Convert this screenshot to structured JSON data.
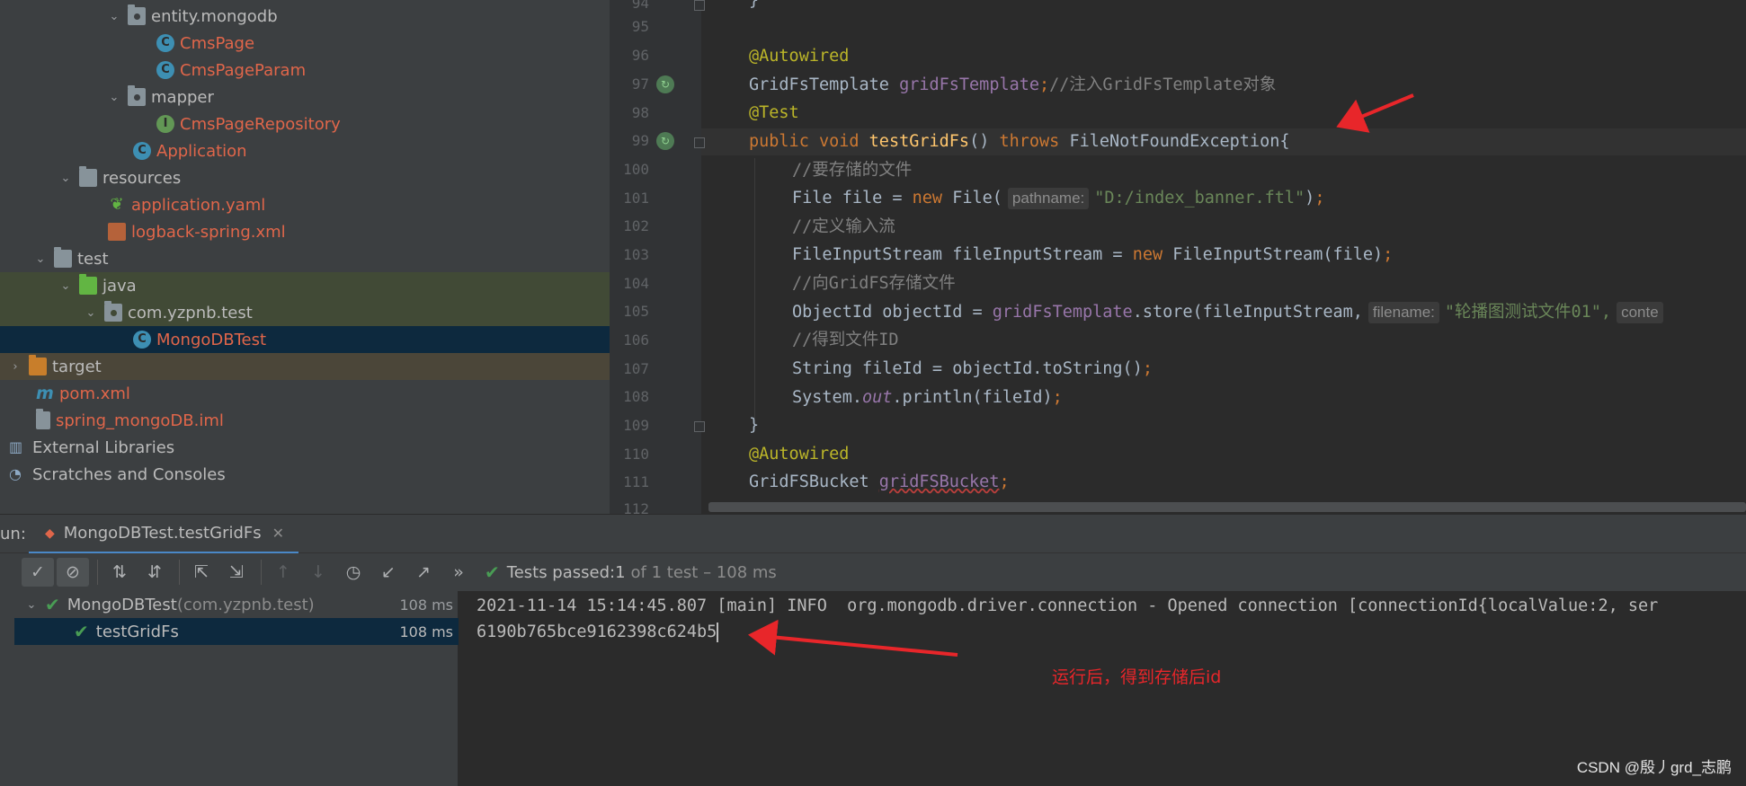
{
  "project_tree": {
    "items": [
      {
        "label": "entity.mongodb",
        "icon": "package-icon"
      },
      {
        "label": "CmsPage",
        "icon": "class-icon"
      },
      {
        "label": "CmsPageParam",
        "icon": "class-icon"
      },
      {
        "label": "mapper",
        "icon": "package-icon"
      },
      {
        "label": "CmsPageRepository",
        "icon": "interface-icon"
      },
      {
        "label": "Application",
        "icon": "spring-class-icon"
      },
      {
        "label": "resources",
        "icon": "resources-folder-icon"
      },
      {
        "label": "application.yaml",
        "icon": "spring-config-icon"
      },
      {
        "label": "logback-spring.xml",
        "icon": "xml-file-icon"
      },
      {
        "label": "test",
        "icon": "folder-icon"
      },
      {
        "label": "java",
        "icon": "test-source-folder-icon"
      },
      {
        "label": "com.yzpnb.test",
        "icon": "package-icon"
      },
      {
        "label": "MongoDBTest",
        "icon": "test-class-icon"
      },
      {
        "label": "target",
        "icon": "excluded-folder-icon"
      },
      {
        "label": "pom.xml",
        "icon": "maven-icon"
      },
      {
        "label": "spring_mongoDB.iml",
        "icon": "module-file-icon"
      },
      {
        "label": "External Libraries",
        "icon": "libraries-icon"
      },
      {
        "label": "Scratches and Consoles",
        "icon": "scratches-icon"
      }
    ]
  },
  "editor": {
    "line_numbers": [
      "94",
      "95",
      "96",
      "97",
      "98",
      "99",
      "100",
      "101",
      "102",
      "103",
      "104",
      "105",
      "106",
      "107",
      "108",
      "109",
      "110",
      "111",
      "112"
    ],
    "code": {
      "l94": "}",
      "l96": "@Autowired",
      "l97_type": "GridFsTemplate ",
      "l97_field": "gridFsTemplate",
      "l97_semi": ";",
      "l97_comment": "//注入GridFsTemplate对象",
      "l98": "@Test",
      "l99_public": "public ",
      "l99_void": "void ",
      "l99_name": "testGridFs",
      "l99_paren": "() ",
      "l99_throws": "throws ",
      "l99_rest": "FileNotFoundException{",
      "l100": "//要存储的文件",
      "l101_a": "File file = ",
      "l101_new": "new ",
      "l101_b": "File(",
      "l101_hint": "pathname:",
      "l101_str": "\"D:/index_banner.ftl\"",
      "l101_c": ")",
      "l101_semi": ";",
      "l102": "//定义输入流",
      "l103_a": "FileInputStream fileInputStream = ",
      "l103_new": "new ",
      "l103_b": "FileInputStream(file)",
      "l103_semi": ";",
      "l104": "//向GridFS存储文件",
      "l105_a": "ObjectId objectId = ",
      "l105_field": "gridFsTemplate",
      "l105_b": ".store(fileInputStream,",
      "l105_hint": "filename:",
      "l105_str": "\"轮播图测试文件01\",",
      "l105_hint2": "conte",
      "l106": "//得到文件ID",
      "l107_a": "String fileId = objectId.toString()",
      "l107_semi": ";",
      "l108_a": "System.",
      "l108_out": "out",
      "l108_b": ".println(fileId)",
      "l108_semi": ";",
      "l109": "}",
      "l110": "@Autowired",
      "l111_type": "GridFSBucket ",
      "l111_field": "gridFSBucket",
      "l111_semi": ";"
    }
  },
  "run": {
    "label": "un:",
    "tab_title": "MongoDBTest.testGridFs",
    "status_prefix": "Tests passed: ",
    "status_count": "1",
    "status_suffix": " of 1 test – 108 ms",
    "tree": [
      {
        "name": "MongoDBTest",
        "package": " (com.yzpnb.test)",
        "duration": "108 ms"
      },
      {
        "name": "testGridFs",
        "duration": "108 ms"
      }
    ],
    "console": [
      "2021-11-14 15:14:45.807 [main] INFO  org.mongodb.driver.connection - Opened connection [connectionId{localValue:2, ser",
      "6190b765bce9162398c624b5"
    ]
  },
  "annotation": {
    "note": "运行后，得到存储后id",
    "color": "#e8262a"
  },
  "watermark": "CSDN @殷丿grd_志鹏",
  "colors": {
    "keyword": "#cc7832",
    "annotation": "#bbb529",
    "method": "#ffc66d",
    "field": "#9876aa",
    "string": "#6a8759",
    "comment": "#808080",
    "selection": "#0d293e",
    "passed": "#499c54"
  }
}
